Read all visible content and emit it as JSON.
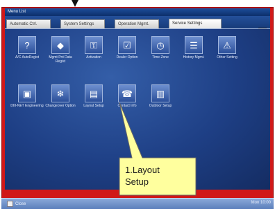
{
  "window": {
    "title": "Menu List"
  },
  "tabs": [
    {
      "label": "Automatic Ctrl."
    },
    {
      "label": "System Settings"
    },
    {
      "label": "Operation Mgmt."
    },
    {
      "label": "Service Settings",
      "active": true
    }
  ],
  "icons_row1": [
    {
      "label": "A/C AutoRegist",
      "icon": "ac-register-icon",
      "glyph": "?"
    },
    {
      "label": "Mgmt Pnt Data Regist",
      "icon": "data-register-icon",
      "glyph": "◆"
    },
    {
      "label": "Activation",
      "icon": "key-icon",
      "glyph": "⚿"
    },
    {
      "label": "Dealer Option",
      "icon": "checkbox-icon",
      "glyph": "☑"
    },
    {
      "label": "Time Zone",
      "icon": "clock-globe-icon",
      "glyph": "◷"
    },
    {
      "label": "History Mgmt.",
      "icon": "document-icon",
      "glyph": "☰"
    },
    {
      "label": "Other Setting",
      "icon": "warning-lv-icon",
      "glyph": "⚠"
    }
  ],
  "icons_row2": [
    {
      "label": "DIII-NET Engineering",
      "icon": "network-icon",
      "glyph": "▣"
    },
    {
      "label": "Changeover Option",
      "icon": "snowflake-sun-icon",
      "glyph": "❄"
    },
    {
      "label": "Layout Setup",
      "icon": "layout-icon",
      "glyph": "▤"
    },
    {
      "label": "Contact Info",
      "icon": "contact-icon",
      "glyph": "☎"
    },
    {
      "label": "Outdoor Setup",
      "icon": "outdoor-icon",
      "glyph": "▥"
    }
  ],
  "callout": {
    "line1": "1.Layout",
    "line2": "Setup"
  },
  "bottom": {
    "close_label": "Close",
    "clock": "Mon 10:00"
  },
  "colors": {
    "frame": "#d01818",
    "panel": "#1e3f85",
    "callout": "#ffff9e"
  }
}
